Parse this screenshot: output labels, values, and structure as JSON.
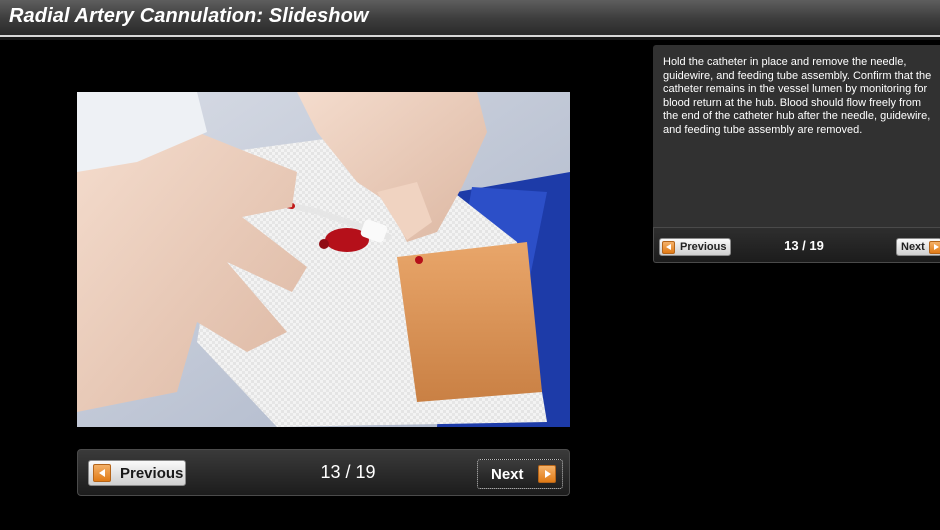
{
  "header": {
    "title": "Radial Artery Cannulation: Slideshow"
  },
  "slide": {
    "image_alt": "photo-catheter-insertion-wrist"
  },
  "navigation": {
    "previous_label": "Previous",
    "next_label": "Next",
    "counter": "13 / 19"
  },
  "caption": {
    "text": "Hold the catheter in place and remove the needle, guidewire, and feeding tube assembly. Confirm that the catheter remains in the vessel lumen by monitoring for blood return at the hub. Blood should flow freely from the end of the catheter hub after the needle, guidewire, and feeding tube assembly are removed."
  },
  "side_navigation": {
    "previous_label": "Previous",
    "next_label": "Next",
    "counter": "13 / 19"
  },
  "colors": {
    "background": "#000000",
    "accent_orange": "#e17b16",
    "caption_panel": "#313131"
  }
}
